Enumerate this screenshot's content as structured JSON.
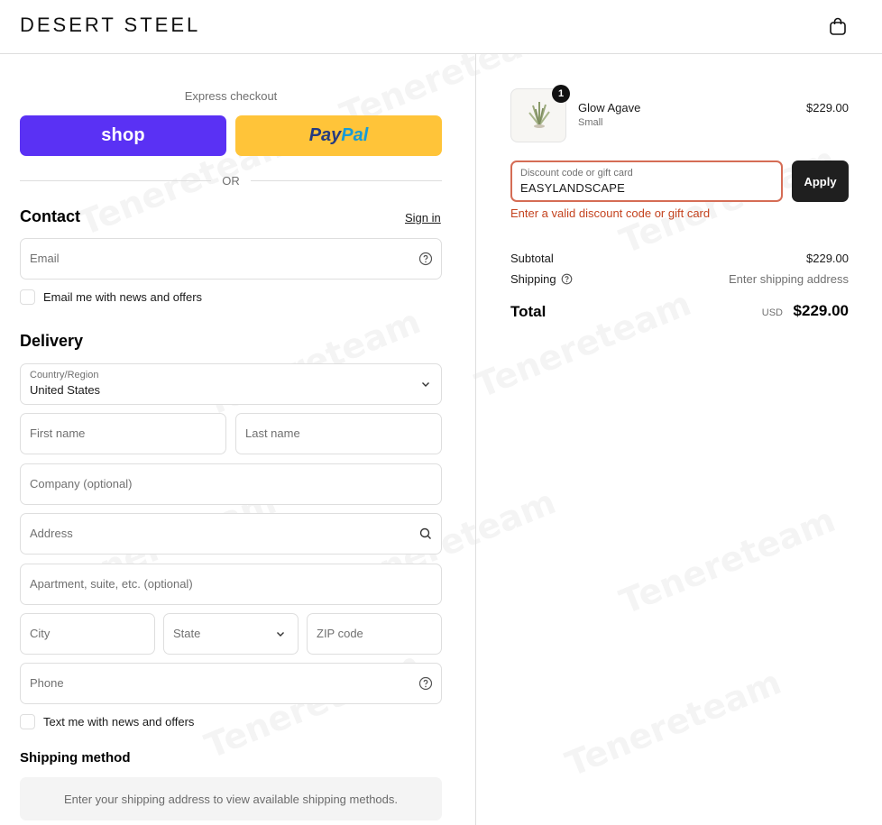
{
  "header": {
    "brand": "DESERT STEEL",
    "cart_icon": "shopping-bag-icon"
  },
  "express": {
    "label": "Express checkout",
    "shop_label": "shop",
    "paypal_part1": "Pay",
    "paypal_part2": "Pal",
    "or_label": "OR"
  },
  "contact": {
    "title": "Contact",
    "sign_in": "Sign in",
    "email_placeholder": "Email",
    "email_offers": "Email me with news and offers"
  },
  "delivery": {
    "title": "Delivery",
    "country_label": "Country/Region",
    "country_value": "United States",
    "first_name": "First name",
    "last_name": "Last name",
    "company": "Company (optional)",
    "address": "Address",
    "apartment": "Apartment, suite, etc. (optional)",
    "city": "City",
    "state": "State",
    "zip": "ZIP code",
    "phone": "Phone",
    "text_offers": "Text me with news and offers"
  },
  "shipping_method": {
    "title": "Shipping method",
    "message": "Enter your shipping address to view available shipping methods."
  },
  "order": {
    "item": {
      "quantity": "1",
      "name": "Glow Agave",
      "variant": "Small",
      "price": "$229.00"
    },
    "discount": {
      "label": "Discount code or gift card",
      "value": "EASYLANDSCAPE",
      "apply_label": "Apply",
      "error": "Enter a valid discount code or gift card"
    },
    "subtotal_label": "Subtotal",
    "subtotal_value": "$229.00",
    "shipping_label": "Shipping",
    "shipping_value": "Enter shipping address",
    "total_label": "Total",
    "total_currency": "USD",
    "total_value": "$229.00"
  },
  "watermark_text": "Tenereteam",
  "colors": {
    "shop_purple": "#5a31f4",
    "paypal_yellow": "#ffc439",
    "error_red": "#c4431f",
    "apply_dark": "#1f1f1f"
  }
}
